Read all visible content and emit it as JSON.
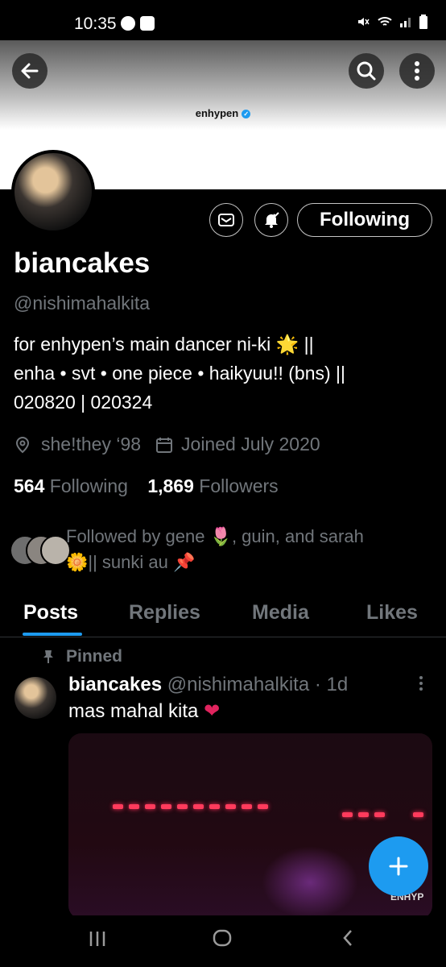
{
  "status_bar": {
    "time": "10:35"
  },
  "banner": {
    "name": "enhypen",
    "verified_icon": "verified-badge-icon"
  },
  "header_buttons": {
    "back": "back-arrow-icon",
    "search": "search-icon",
    "more": "more-vertical-icon"
  },
  "profile": {
    "display_name": "biancakes",
    "handle": "@nishimahalkita",
    "bio_lines": [
      "for enhypen’s main dancer ni-ki 🌟 ||",
      "enha • svt • one piece • haikyuu!! (bns) ||",
      "020820 | 020324"
    ],
    "location": "she!they ‘98",
    "joined": "Joined July 2020",
    "following_count": "564",
    "following_label": "Following",
    "followers_count": "1,869",
    "followers_label": "Followers",
    "followed_by_line1": "Followed by gene 🌷, guin, and sarah",
    "followed_by_line2": "🌼|| sunki au 📌"
  },
  "actions": {
    "following_button": "Following",
    "message_icon": "message-icon",
    "notification_icon": "bell-check-icon"
  },
  "tabs": [
    {
      "label": "Posts",
      "active": true
    },
    {
      "label": "Replies",
      "active": false
    },
    {
      "label": "Media",
      "active": false
    },
    {
      "label": "Likes",
      "active": false
    }
  ],
  "post": {
    "pinned_label": "Pinned",
    "author": "biancakes",
    "handle_time": "@nishimahalkita · 1d",
    "text": "mas mahal kita",
    "media_watermark": "ENHYP"
  },
  "colors": {
    "accent": "#1d9bf0",
    "background": "#000000",
    "muted": "#71767b",
    "heart": "#e0245e"
  }
}
